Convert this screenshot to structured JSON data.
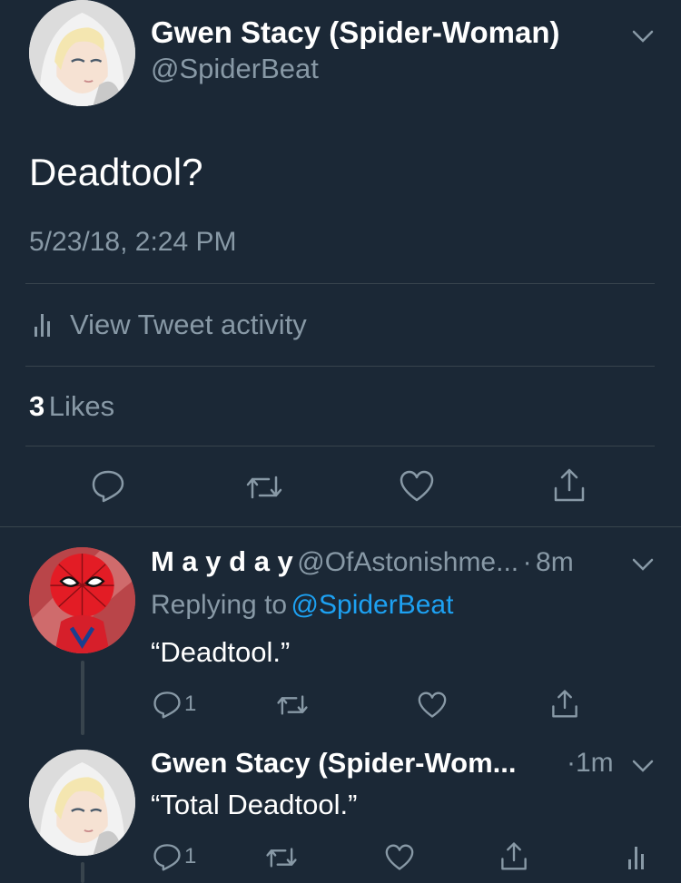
{
  "main_tweet": {
    "display_name": "Gwen Stacy (Spider-Woman)",
    "handle": "@SpiderBeat",
    "text": "Deadtool?",
    "timestamp": "5/23/18, 2:24 PM",
    "activity_label": "View Tweet activity",
    "likes_count": "3",
    "likes_label": "Likes"
  },
  "reply_1": {
    "display_name": "M a y d a y",
    "handle": "@OfAstonishme...",
    "time": "8m",
    "replying_prefix": "Replying to",
    "replying_handle": "@SpiderBeat",
    "text": "“Deadtool.”",
    "reply_count": "1"
  },
  "reply_2": {
    "display_name": "Gwen Stacy (Spider-Wom...",
    "time": "1m",
    "text": "“Total Deadtool.”",
    "reply_count": "1"
  },
  "colors": {
    "background": "#1b2836",
    "muted": "#8899a6",
    "link": "#1da1f2",
    "divider": "#38444d"
  },
  "icons": [
    "chevron-down-icon",
    "bar-chart-icon",
    "reply-icon",
    "retweet-icon",
    "heart-icon",
    "share-icon"
  ]
}
